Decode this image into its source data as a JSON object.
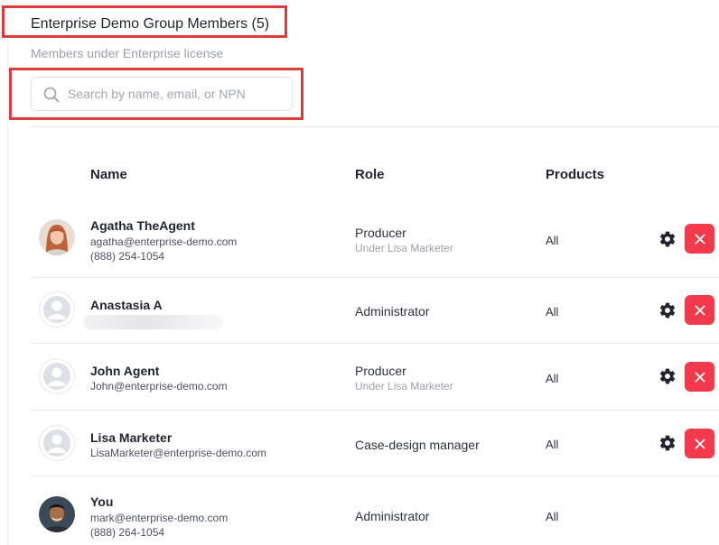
{
  "header": {
    "title": "Enterprise Demo Group Members (5)",
    "subtitle": "Members under Enterprise license"
  },
  "search": {
    "placeholder": "Search by name, email, or NPN",
    "value": ""
  },
  "columns": {
    "name": "Name",
    "role": "Role",
    "products": "Products"
  },
  "members": [
    {
      "name": "Agatha TheAgent",
      "email": "agatha@enterprise-demo.com",
      "phone": "(888) 254-1054",
      "role": "Producer",
      "role_note": "Under Lisa Marketer",
      "products": "All",
      "avatar": "photo"
    },
    {
      "name": "Anastasia A",
      "role": "Administrator",
      "products": "All",
      "avatar": "placeholder"
    },
    {
      "name": "John Agent",
      "email": "John@enterprise-demo.com",
      "role": "Producer",
      "role_note": "Under Lisa Marketer",
      "products": "All",
      "avatar": "placeholder"
    },
    {
      "name": "Lisa Marketer",
      "email": "LisaMarketer@enterprise-demo.com",
      "role": "Case-design manager",
      "products": "All",
      "avatar": "placeholder"
    },
    {
      "name": "You",
      "email": "mark@enterprise-demo.com",
      "phone": "(888) 264-1054",
      "role": "Administrator",
      "products": "All",
      "avatar": "photo"
    }
  ],
  "colors": {
    "highlight": "#e03a3a",
    "remove_button": "#f23a4c",
    "muted_text": "#9aa1ab"
  }
}
